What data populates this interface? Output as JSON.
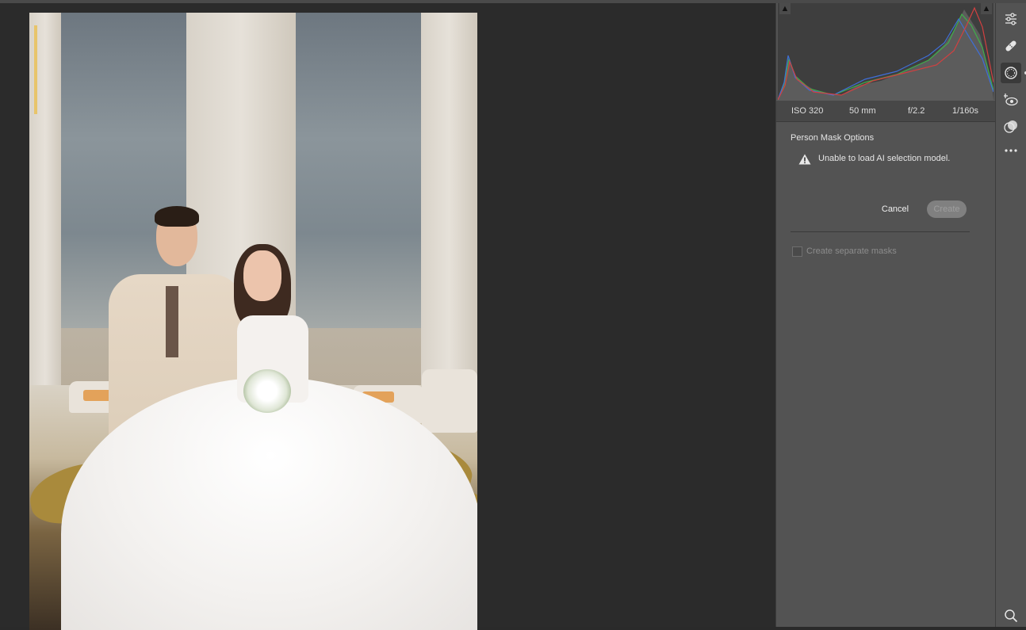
{
  "exif": {
    "iso": "ISO 320",
    "focal_length": "50 mm",
    "aperture": "f/2.2",
    "shutter": "1/160s"
  },
  "mask_options": {
    "title": "Person Mask Options",
    "warning": "Unable to load AI selection model.",
    "cancel_label": "Cancel",
    "create_label": "Create",
    "separate_masks_label": "Create separate masks",
    "separate_masks_checked": false
  },
  "toolbar": {
    "tools": [
      "edit-icon",
      "healing-icon",
      "masking-icon",
      "red-eye-icon",
      "presets-icon",
      "more-icon",
      "zoom-icon"
    ],
    "active_tool": "masking-icon"
  },
  "colors": {
    "panel_bg": "#535353",
    "canvas_bg": "#2b2b2b",
    "histogram_red": "#d24040",
    "histogram_green": "#3fae4a",
    "histogram_blue": "#3f6fd8"
  }
}
